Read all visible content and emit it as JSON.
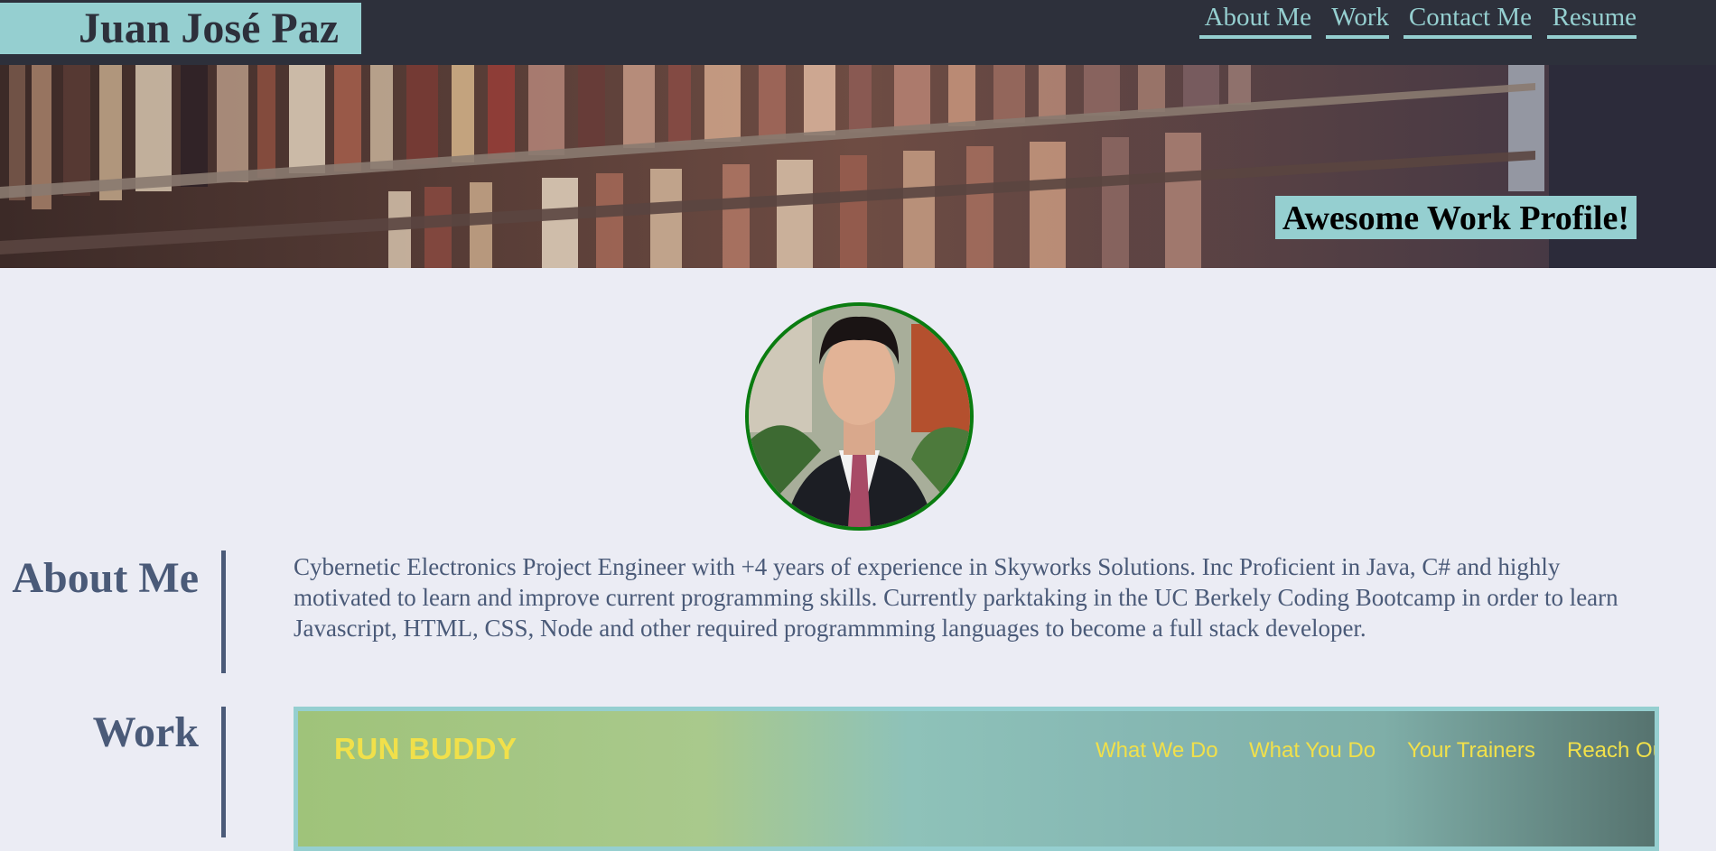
{
  "header": {
    "site_title": "Juan José Paz",
    "nav": [
      {
        "label": "About Me"
      },
      {
        "label": "Work"
      },
      {
        "label": "Contact Me"
      },
      {
        "label": "Resume"
      }
    ]
  },
  "hero": {
    "tagline": "Awesome Work Profile!"
  },
  "about": {
    "title": "About Me",
    "body": "Cybernetic Electronics Project Engineer with +4 years of experience in Skyworks Solutions. Inc Proficient in Java, C# and highly motivated to learn and improve current programming skills. Currently parktaking in the UC Berkely Coding Bootcamp in order to learn Javascript, HTML, CSS, Node and other required programmming languages to become a full stack developer."
  },
  "work": {
    "title": "Work",
    "project": {
      "brand": "RUN BUDDY",
      "links": [
        "What We Do",
        "What You Do",
        "Your Trainers",
        "Reach Ou"
      ]
    }
  },
  "colors": {
    "header_bg": "#2d303b",
    "accent": "#95cfd0",
    "page_bg": "#ebecf4",
    "heading": "#4a5a78",
    "avatar_border": "#0a7c10",
    "card_link": "#f1e04a"
  },
  "icons": {
    "avatar": "profile-photo",
    "hero": "bookshelf-photo"
  }
}
